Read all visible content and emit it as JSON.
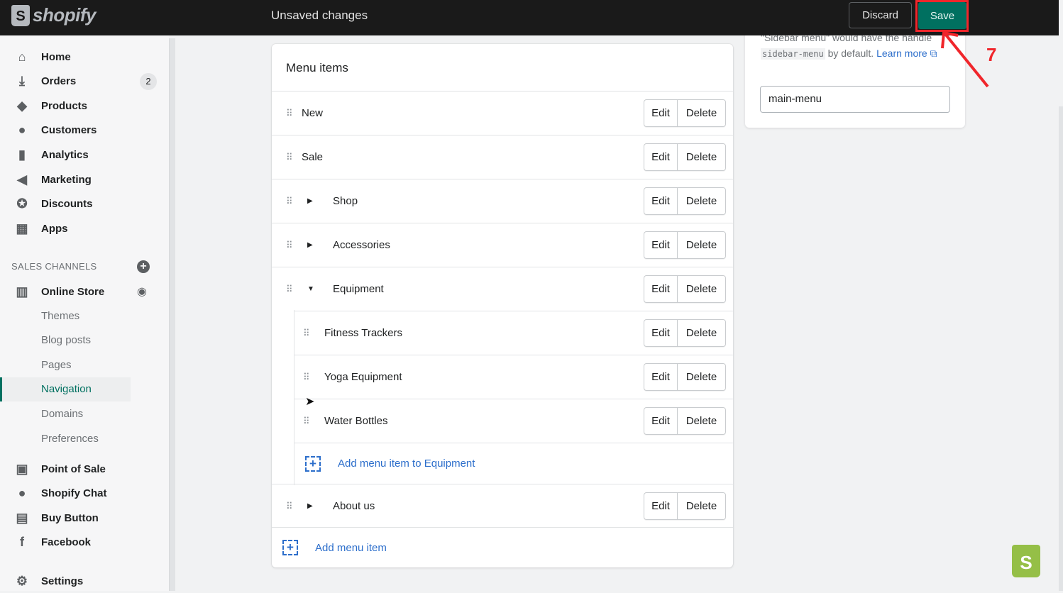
{
  "topbar": {
    "logo": "shopify",
    "status": "Unsaved changes",
    "discard": "Discard",
    "save": "Save"
  },
  "annotation": {
    "step": "7",
    "color": "#f0262b"
  },
  "sidebar": {
    "items": [
      {
        "label": "Home",
        "icon": "home-icon",
        "glyph": "⌂"
      },
      {
        "label": "Orders",
        "icon": "orders-icon",
        "glyph": "⤓",
        "badge": "2"
      },
      {
        "label": "Products",
        "icon": "tag-icon",
        "glyph": "◆"
      },
      {
        "label": "Customers",
        "icon": "person-icon",
        "glyph": "●"
      },
      {
        "label": "Analytics",
        "icon": "bar-chart-icon",
        "glyph": "▮"
      },
      {
        "label": "Marketing",
        "icon": "megaphone-icon",
        "glyph": "◀"
      },
      {
        "label": "Discounts",
        "icon": "discount-icon",
        "glyph": "✪"
      },
      {
        "label": "Apps",
        "icon": "apps-icon",
        "glyph": "▦"
      }
    ],
    "sales_channels": "SALES CHANNELS",
    "online_store": "Online Store",
    "sub_items": [
      "Themes",
      "Blog posts",
      "Pages",
      "Navigation",
      "Domains",
      "Preferences"
    ],
    "active": "Navigation",
    "channels": [
      {
        "label": "Point of Sale",
        "icon": "pos-icon",
        "glyph": "▣"
      },
      {
        "label": "Shopify Chat",
        "icon": "chat-icon",
        "glyph": "●"
      },
      {
        "label": "Buy Button",
        "icon": "buy-button-icon",
        "glyph": "▤"
      },
      {
        "label": "Facebook",
        "icon": "facebook-icon",
        "glyph": "f"
      }
    ],
    "settings": "Settings"
  },
  "menu": {
    "title": "Menu items",
    "edit": "Edit",
    "delete": "Delete",
    "items": [
      {
        "label": "New",
        "level": 0,
        "caret": ""
      },
      {
        "label": "Sale",
        "level": 0,
        "caret": ""
      },
      {
        "label": "Shop",
        "level": 0,
        "caret": "right"
      },
      {
        "label": "Accessories",
        "level": 0,
        "caret": "right"
      },
      {
        "label": "Equipment",
        "level": 0,
        "caret": "down"
      },
      {
        "label": "Fitness Trackers",
        "level": 1,
        "caret": ""
      },
      {
        "label": "Yoga Equipment",
        "level": 1,
        "caret": ""
      },
      {
        "label": "Water Bottles",
        "level": 1,
        "caret": ""
      }
    ],
    "add_child": "Add menu item to Equipment",
    "last_item": {
      "label": "About us",
      "caret": "right"
    },
    "add_item": "Add menu item"
  },
  "handle": {
    "text_pre": "\"Sidebar menu\" would have the handle",
    "code": "sidebar-menu",
    "text_post": " by default. ",
    "learn_more": "Learn more",
    "value": "main-menu"
  },
  "colors": {
    "primary": "#007060",
    "link": "#2c6ecb"
  }
}
